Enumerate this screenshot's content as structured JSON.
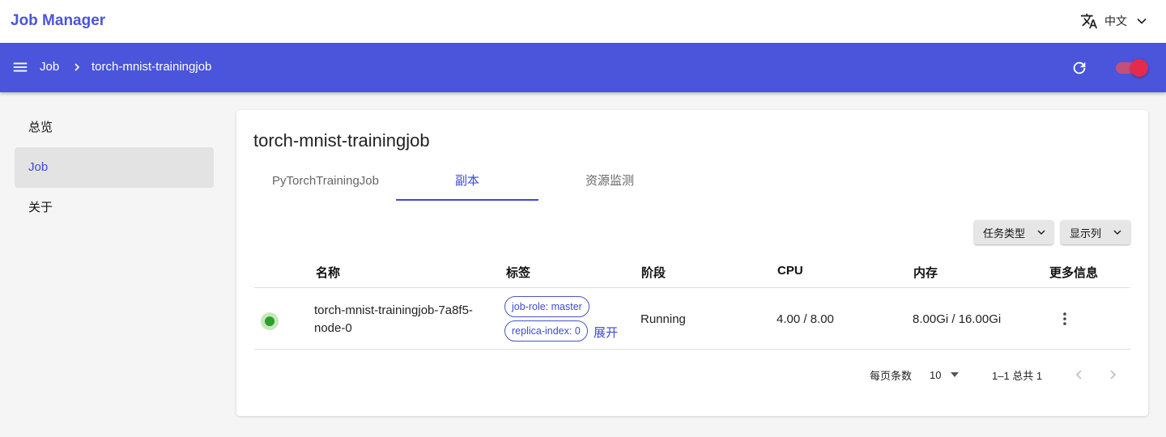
{
  "app": {
    "title": "Job Manager"
  },
  "language": {
    "icon": "translate-icon",
    "label": "中文",
    "dropdown_icon": "chevron-down-icon"
  },
  "header": {
    "color": "#4a55dc",
    "breadcrumb": [
      "Job",
      "torch-mnist-trainingjob"
    ],
    "refresh_icon": "refresh-icon",
    "theme_toggle": {
      "on": true,
      "color": "#e6294d"
    }
  },
  "sidebar": {
    "items": [
      {
        "label": "总览",
        "active": false
      },
      {
        "label": "Job",
        "active": true
      },
      {
        "label": "关于",
        "active": false
      }
    ]
  },
  "main": {
    "title": "torch-mnist-trainingjob",
    "tabs": [
      {
        "label": "PyTorchTrainingJob",
        "active": false
      },
      {
        "label": "副本",
        "active": true
      },
      {
        "label": "资源监测",
        "active": false
      }
    ],
    "filters": {
      "task_type": "任务类型",
      "columns": "显示列"
    },
    "table": {
      "headers": {
        "name": "名称",
        "labels": "标签",
        "phase": "阶段",
        "cpu": "CPU",
        "memory": "内存",
        "more": "更多信息"
      },
      "rows": [
        {
          "status_color": "#2aa02a",
          "name_line1": "torch-mnist-trainingjob-7a8f5-",
          "name_line2": "node-0",
          "labels": [
            "job-role: master",
            "replica-index: 0"
          ],
          "expand": "展开",
          "phase": "Running",
          "cpu": "4.00 / 8.00",
          "memory": "8.00Gi / 16.00Gi"
        }
      ]
    },
    "pagination": {
      "rows_per_page_label": "每页条数",
      "rows_per_page": "10",
      "range": "1–1 总共 1"
    }
  }
}
